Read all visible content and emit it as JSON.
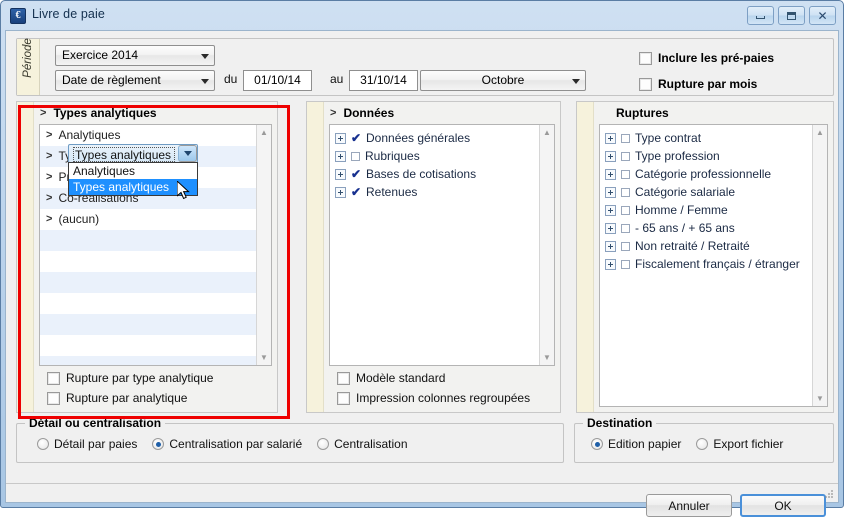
{
  "window": {
    "title": "Livre de paie",
    "icon": "app-icon",
    "buttons": {
      "minimize": "minimize-icon",
      "maximize": "maximize-icon",
      "close": "close-icon"
    }
  },
  "periode": {
    "legend": "Période",
    "exercice": {
      "value": "Exercice 2014"
    },
    "date_type": {
      "value": "Date de règlement"
    },
    "du_label": "du",
    "du_value": "01/10/14",
    "au_label": "au",
    "au_value": "31/10/14",
    "mois": {
      "value": "Octobre"
    },
    "checkboxes": [
      {
        "label": "Inclure les pré-paies",
        "checked": false
      },
      {
        "label": "Rupture par mois",
        "checked": false
      }
    ]
  },
  "panel_analytiques": {
    "header": "Types analytiques",
    "chevron": ">",
    "items": [
      {
        "label": "Analytiques",
        "arrow": ">"
      },
      {
        "label": "Types analytiques",
        "arrow": ">"
      },
      {
        "label": "Productions",
        "arrow": ">"
      },
      {
        "label": "Co-réalisations",
        "arrow": ">"
      },
      {
        "label": "(aucun)",
        "arrow": ">"
      }
    ],
    "footer_checkboxes": [
      {
        "label": "Rupture par type analytique",
        "checked": false
      },
      {
        "label": "Rupture par analytique",
        "checked": false
      }
    ]
  },
  "dropdown": {
    "selected_value": "Types analytiques",
    "open": true,
    "options": [
      {
        "label": "Analytiques",
        "selected": false
      },
      {
        "label": "Types analytiques",
        "selected": true
      }
    ]
  },
  "panel_donnees": {
    "header": "Données",
    "chevron": ">",
    "items": [
      {
        "label": "Données générales",
        "checked": true
      },
      {
        "label": "Rubriques",
        "checked": false
      },
      {
        "label": "Bases de cotisations",
        "checked": true
      },
      {
        "label": "Retenues",
        "checked": true
      }
    ],
    "footer_checkboxes": [
      {
        "label": "Modèle standard",
        "checked": false
      },
      {
        "label": "Impression colonnes regroupées",
        "checked": false
      }
    ]
  },
  "panel_ruptures": {
    "header": "Ruptures",
    "items": [
      {
        "label": "Type contrat",
        "checked": false
      },
      {
        "label": "Type profession",
        "checked": false
      },
      {
        "label": "Catégorie professionnelle",
        "checked": false
      },
      {
        "label": "Catégorie salariale",
        "checked": false
      },
      {
        "label": "Homme / Femme",
        "checked": false
      },
      {
        "label": "- 65 ans / + 65 ans",
        "checked": false
      },
      {
        "label": "Non retraité / Retraité",
        "checked": false
      },
      {
        "label": "Fiscalement français / étranger",
        "checked": false
      }
    ]
  },
  "detail_group": {
    "legend": "Détail ou centralisation",
    "options": [
      {
        "label": "Détail par paies",
        "selected": false
      },
      {
        "label": "Centralisation par salarié",
        "selected": true
      },
      {
        "label": "Centralisation",
        "selected": false
      }
    ]
  },
  "destination_group": {
    "legend": "Destination",
    "options": [
      {
        "label": "Edition papier",
        "selected": true
      },
      {
        "label": "Export fichier",
        "selected": false
      }
    ]
  },
  "footer": {
    "cancel_label": "Annuler",
    "ok_label": "OK"
  },
  "annotation": {
    "highlight_color": "#ee0000"
  }
}
